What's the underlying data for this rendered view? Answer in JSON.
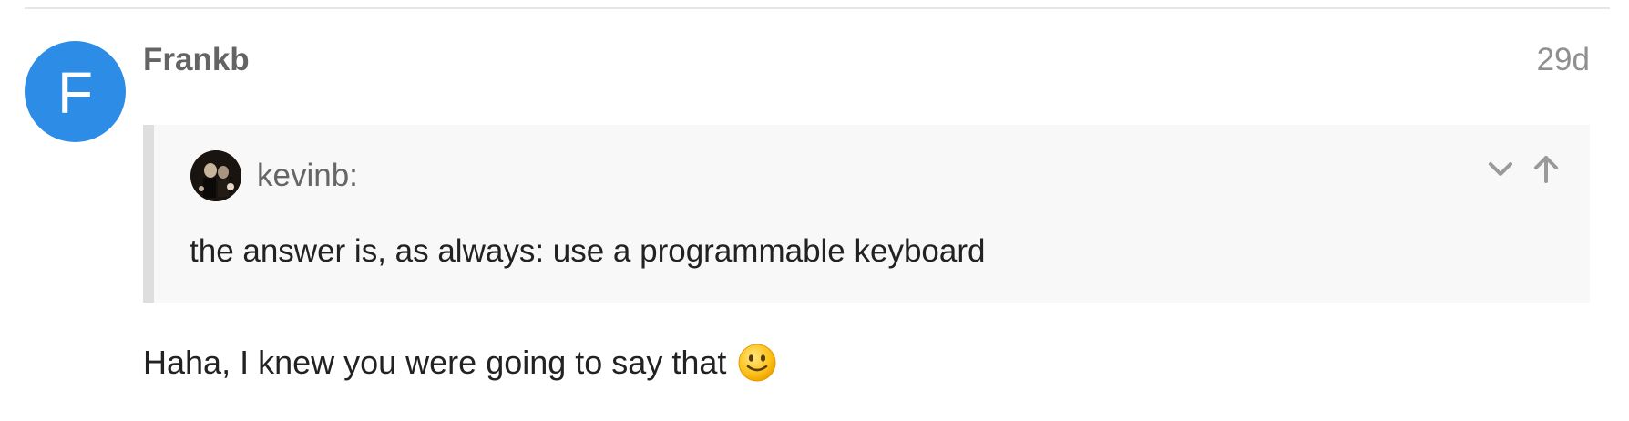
{
  "post": {
    "author": "Frankb",
    "avatar_letter": "F",
    "avatar_color": "#2d8de6",
    "date": "29d",
    "quote": {
      "author": "kevinb:",
      "text": "the answer is, as always: use a programmable keyboard",
      "controls": [
        "chevron-down-icon",
        "arrow-up-icon"
      ]
    },
    "body": {
      "text": "Haha, I knew you were going to say that",
      "emoji": "slight-smile-emoji"
    }
  }
}
